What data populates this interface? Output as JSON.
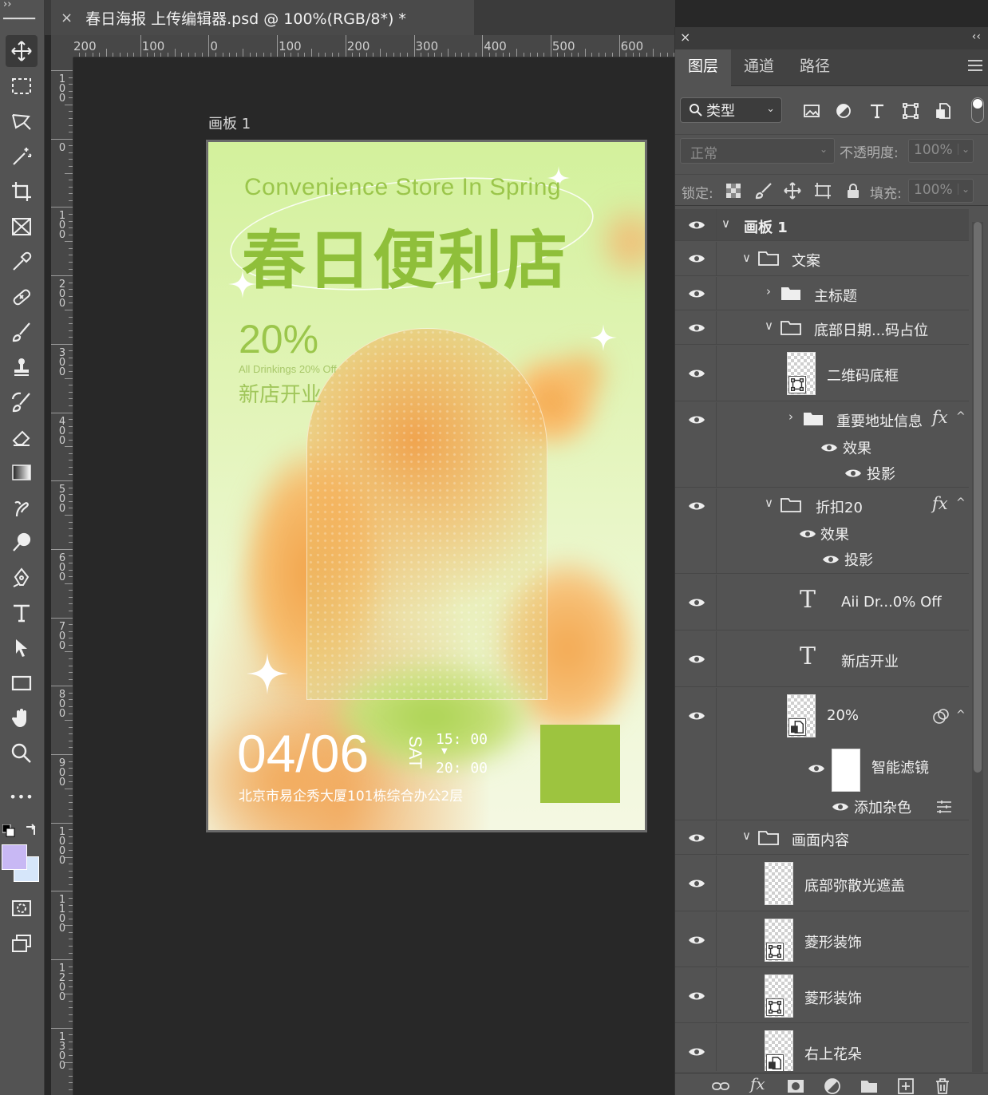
{
  "document": {
    "tab_title": "春日海报 上传编辑器.psd @ 100%(RGB/8*) *",
    "close_glyph": "×",
    "artboard_label": "画板 1"
  },
  "rulers": {
    "horizontal": [
      "200",
      "100",
      "0",
      "100",
      "200",
      "300",
      "400",
      "500",
      "600"
    ],
    "vertical": [
      "100",
      "0",
      "100",
      "200",
      "300",
      "400",
      "500",
      "600",
      "700",
      "800",
      "900",
      "1000",
      "1100",
      "1200",
      "1300"
    ]
  },
  "toolbar": {
    "tools": [
      "move-tool",
      "marquee-tool",
      "lasso-tool",
      "magic-wand-tool",
      "crop-tool",
      "frame-tool",
      "eyedropper-tool",
      "healing-brush-tool",
      "brush-tool",
      "clone-stamp-tool",
      "history-brush-tool",
      "eraser-tool",
      "gradient-tool",
      "smudge-tool",
      "dodge-tool",
      "pen-tool",
      "type-tool",
      "path-selection-tool",
      "rectangle-tool",
      "hand-tool",
      "zoom-tool",
      "more-tools"
    ],
    "foreground_color": "#c8b8f4",
    "background_color": "#d6e6fa",
    "more_glyph": "•••"
  },
  "poster": {
    "subtitle_en": "Convenience Store In Spring",
    "title_cn": "春日便利店",
    "discount": "20%",
    "discount_note": "All Drinkings 20% Off",
    "opening": "新店开业",
    "date": "04/06",
    "weekday": "SAT",
    "time_start": "15: 00",
    "time_end": "20: 00",
    "address": "北京市易企秀大厦101栋综合办公2层",
    "qr_placeholder_color": "#9dc43f",
    "title_color": "#8fbf3a"
  },
  "panel": {
    "close_glyph": "×",
    "collapse_glyph": "‹‹",
    "tabs": [
      "图层",
      "通道",
      "路径"
    ],
    "filter_label": "类型",
    "blend_mode": "正常",
    "opacity_label": "不透明度:",
    "opacity_value": "100%",
    "lock_label": "锁定:",
    "fill_label": "填充:",
    "fill_value": "100%",
    "chevron": "⌄",
    "twisty_open": "∨",
    "twisty_closed": "›",
    "fx_glyph": "fx",
    "caret_up": "^",
    "type_glyph": "T"
  },
  "layers": [
    {
      "name": "画板 1",
      "kind": "artboard"
    },
    {
      "name": "文案",
      "kind": "group-open"
    },
    {
      "name": "主标题",
      "kind": "group-closed"
    },
    {
      "name": "底部日期...码占位",
      "kind": "group-open"
    },
    {
      "name": "二维码底框",
      "kind": "shape"
    },
    {
      "name": "重要地址信息",
      "kind": "group-closed-fx",
      "effects_label": "效果",
      "effect": "投影"
    },
    {
      "name": "折扣20",
      "kind": "group-open-fx",
      "effects_label": "效果",
      "effect": "投影"
    },
    {
      "name": "Aii Dr...0% Off",
      "kind": "text"
    },
    {
      "name": "新店开业",
      "kind": "text"
    },
    {
      "name": "20%",
      "kind": "smart-object",
      "filters_label": "智能滤镜",
      "filter": "添加杂色"
    },
    {
      "name": "画面内容",
      "kind": "group-open"
    },
    {
      "name": "底部弥散光遮盖",
      "kind": "raster"
    },
    {
      "name": "菱形装饰",
      "kind": "shape"
    },
    {
      "name": "菱形装饰",
      "kind": "shape"
    },
    {
      "name": "右上花朵",
      "kind": "smart-object"
    }
  ]
}
